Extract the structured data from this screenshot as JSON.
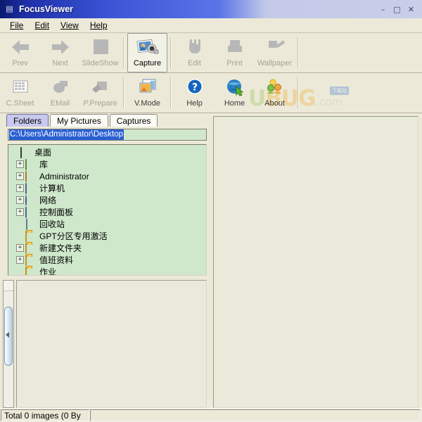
{
  "window": {
    "title": "FocusViewer",
    "app_icon": "app-logo-icon",
    "buttons": {
      "minimize": "–",
      "maximize": "□",
      "close": "✕"
    }
  },
  "menu": {
    "items": [
      {
        "label": "File",
        "accel": "F"
      },
      {
        "label": "Edit",
        "accel": "E"
      },
      {
        "label": "View",
        "accel": "V"
      },
      {
        "label": "Help",
        "accel": "H"
      }
    ]
  },
  "toolbar_top": {
    "buttons": [
      {
        "label": "Prev",
        "icon": "arrow-left-icon",
        "enabled": false,
        "active": false
      },
      {
        "label": "Next",
        "icon": "arrow-right-icon",
        "enabled": false,
        "active": false
      },
      {
        "label": "SlideShow",
        "icon": "slideshow-icon",
        "enabled": false,
        "active": false
      },
      {
        "label": "Capture",
        "icon": "camera-capture-icon",
        "enabled": true,
        "active": true
      },
      {
        "label": "Edit",
        "icon": "paint-edit-icon",
        "enabled": false,
        "active": false
      },
      {
        "label": "Print",
        "icon": "printer-icon",
        "enabled": false,
        "active": false
      },
      {
        "label": "Wallpaper",
        "icon": "wallpaper-icon",
        "enabled": false,
        "active": false
      }
    ]
  },
  "toolbar_bottom": {
    "buttons": [
      {
        "label": "C.Sheet",
        "icon": "contact-sheet-icon",
        "enabled": false,
        "active": false
      },
      {
        "label": "EMail",
        "icon": "email-icon",
        "enabled": false,
        "active": false
      },
      {
        "label": "P.Prepare",
        "icon": "print-prepare-icon",
        "enabled": false,
        "active": false
      },
      {
        "label": "V.Mode",
        "icon": "view-mode-icon",
        "enabled": true,
        "active": false
      },
      {
        "label": "Help",
        "icon": "help-question-icon",
        "enabled": true,
        "active": false
      },
      {
        "label": "Home",
        "icon": "globe-home-icon",
        "enabled": true,
        "active": false
      },
      {
        "label": "About",
        "icon": "about-people-icon",
        "enabled": true,
        "active": false
      }
    ]
  },
  "watermark": {
    "part_u": "U",
    "part_b": "BUG",
    "badge": "下载站",
    "suffix": ".com"
  },
  "tabs": {
    "items": [
      {
        "label": "Folders",
        "selected": true
      },
      {
        "label": "My Pictures",
        "selected": false
      },
      {
        "label": "Captures",
        "selected": false
      }
    ]
  },
  "address": {
    "value": "C:\\Users\\Administrator\\Desktop",
    "selected": true
  },
  "tree": {
    "items": [
      {
        "label": "桌面",
        "icon": "desktop-icon",
        "expander": "",
        "indent": 0
      },
      {
        "label": "库",
        "icon": "library-icon",
        "expander": "+",
        "indent": 1
      },
      {
        "label": "Administrator",
        "icon": "user-folder-icon",
        "expander": "+",
        "indent": 1
      },
      {
        "label": "计算机",
        "icon": "computer-icon",
        "expander": "+",
        "indent": 1
      },
      {
        "label": "网络",
        "icon": "network-icon",
        "expander": "+",
        "indent": 1
      },
      {
        "label": "控制面板",
        "icon": "control-panel-icon",
        "expander": "+",
        "indent": 1
      },
      {
        "label": "回收站",
        "icon": "recycle-bin-icon",
        "expander": "",
        "indent": 1
      },
      {
        "label": "GPT分区专用激活",
        "icon": "folder-icon",
        "expander": "",
        "indent": 1
      },
      {
        "label": "新建文件夹",
        "icon": "folder-icon",
        "expander": "+",
        "indent": 1
      },
      {
        "label": "值班资料",
        "icon": "folder-icon",
        "expander": "+",
        "indent": 1
      },
      {
        "label": "作业",
        "icon": "folder-icon",
        "expander": "",
        "indent": 1
      }
    ]
  },
  "statusbar": {
    "total_text": "Total 0 images (0 By",
    "right_text": ""
  },
  "colors": {
    "titlebar_blue": "#1d2fa8",
    "tree_green": "#cfe8cb",
    "panel_cream": "#eaeada",
    "chrome": "#ece9d8",
    "tab_selected": "#c9c8ee",
    "selection_blue": "#2a5fd4"
  }
}
